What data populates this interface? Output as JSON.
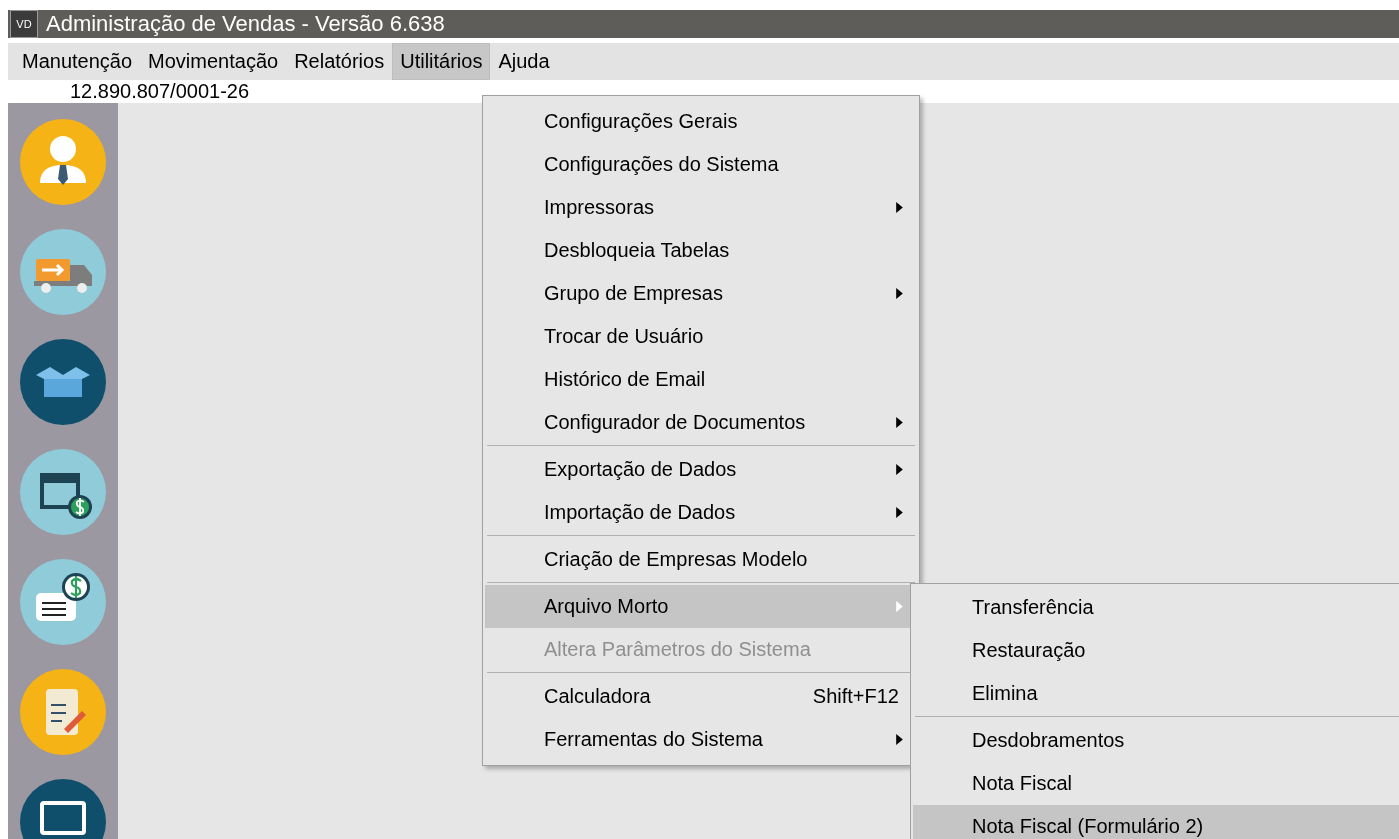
{
  "window": {
    "icon_text": "VD",
    "title": "Administração de Vendas - Versão 6.638"
  },
  "menu_bar": [
    {
      "label": "Manutenção",
      "selected": false
    },
    {
      "label": "Movimentação",
      "selected": false
    },
    {
      "label": "Relatórios",
      "selected": false
    },
    {
      "label": "Utilitários",
      "selected": true
    },
    {
      "label": "Ajuda",
      "selected": false
    }
  ],
  "company_id": "12.890.807/0001-26",
  "dropdown_menu": {
    "groups": [
      [
        {
          "label": "Configurações Gerais",
          "submenu": false,
          "disabled": false,
          "selected": false
        },
        {
          "label": "Configurações do Sistema",
          "submenu": false,
          "disabled": false,
          "selected": false
        },
        {
          "label": "Impressoras",
          "submenu": true,
          "disabled": false,
          "selected": false
        },
        {
          "label": "Desbloqueia Tabelas",
          "submenu": false,
          "disabled": false,
          "selected": false
        },
        {
          "label": "Grupo de Empresas",
          "submenu": true,
          "disabled": false,
          "selected": false
        },
        {
          "label": "Trocar de Usuário",
          "submenu": false,
          "disabled": false,
          "selected": false
        },
        {
          "label": "Histórico de Email",
          "submenu": false,
          "disabled": false,
          "selected": false
        },
        {
          "label": "Configurador de Documentos",
          "submenu": true,
          "disabled": false,
          "selected": false
        }
      ],
      [
        {
          "label": "Exportação de Dados",
          "submenu": true,
          "disabled": false,
          "selected": false
        },
        {
          "label": "Importação de Dados",
          "submenu": true,
          "disabled": false,
          "selected": false
        }
      ],
      [
        {
          "label": "Criação de Empresas Modelo",
          "submenu": false,
          "disabled": false,
          "selected": false
        }
      ],
      [
        {
          "label": "Arquivo Morto",
          "submenu": true,
          "disabled": false,
          "selected": true
        },
        {
          "label": "Altera Parâmetros do Sistema",
          "submenu": false,
          "disabled": true,
          "selected": false
        }
      ],
      [
        {
          "label": "Calculadora",
          "shortcut": "Shift+F12",
          "submenu": false,
          "disabled": false,
          "selected": false
        },
        {
          "label": "Ferramentas do Sistema",
          "submenu": true,
          "disabled": false,
          "selected": false
        }
      ]
    ]
  },
  "submenu": {
    "groups": [
      [
        {
          "label": "Transferência",
          "selected": false
        },
        {
          "label": "Restauração",
          "selected": false
        },
        {
          "label": "Elimina",
          "selected": false
        }
      ],
      [
        {
          "label": "Desdobramentos",
          "selected": false
        },
        {
          "label": "Nota Fiscal",
          "selected": false
        },
        {
          "label": "Nota Fiscal (Formulário 2)",
          "selected": true
        }
      ]
    ]
  }
}
